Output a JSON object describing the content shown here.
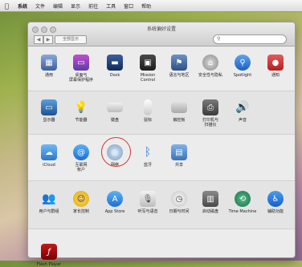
{
  "menubar": {
    "apple": "",
    "items": [
      "系统",
      "文件",
      "编辑",
      "显示",
      "前往",
      "工具",
      "窗口",
      "帮助"
    ]
  },
  "window": {
    "title": "系统偏好设置",
    "nav_back": "◀",
    "nav_forward": "▶",
    "show_all": "全部显示",
    "search_placeholder": ""
  },
  "sections": [
    {
      "items": [
        {
          "label": "通用"
        },
        {
          "label": "桌面与\n屏幕保护程序"
        },
        {
          "label": "Dock"
        },
        {
          "label": "Mission\nControl"
        },
        {
          "label": "语言与地区"
        },
        {
          "label": "安全性与隐私"
        },
        {
          "label": "Spotlight"
        },
        {
          "label": "通知"
        }
      ]
    },
    {
      "items": [
        {
          "label": "显示器"
        },
        {
          "label": "节能器"
        },
        {
          "label": "键盘"
        },
        {
          "label": "鼠标"
        },
        {
          "label": "触控板"
        },
        {
          "label": "打印机与\n扫描仪"
        },
        {
          "label": "声音"
        }
      ]
    },
    {
      "items": [
        {
          "label": "iCloud"
        },
        {
          "label": "互联网\n帐户"
        },
        {
          "label": "网络"
        },
        {
          "label": "蓝牙"
        },
        {
          "label": "共享"
        }
      ]
    },
    {
      "items": [
        {
          "label": "用户与群组"
        },
        {
          "label": "家长控制"
        },
        {
          "label": "App Store"
        },
        {
          "label": "听写与语音"
        },
        {
          "label": "日期与时间"
        },
        {
          "label": "启动磁盘"
        },
        {
          "label": "Time Machine"
        },
        {
          "label": "辅助功能"
        }
      ]
    },
    {
      "items": [
        {
          "label": "Flash Player"
        }
      ]
    }
  ]
}
